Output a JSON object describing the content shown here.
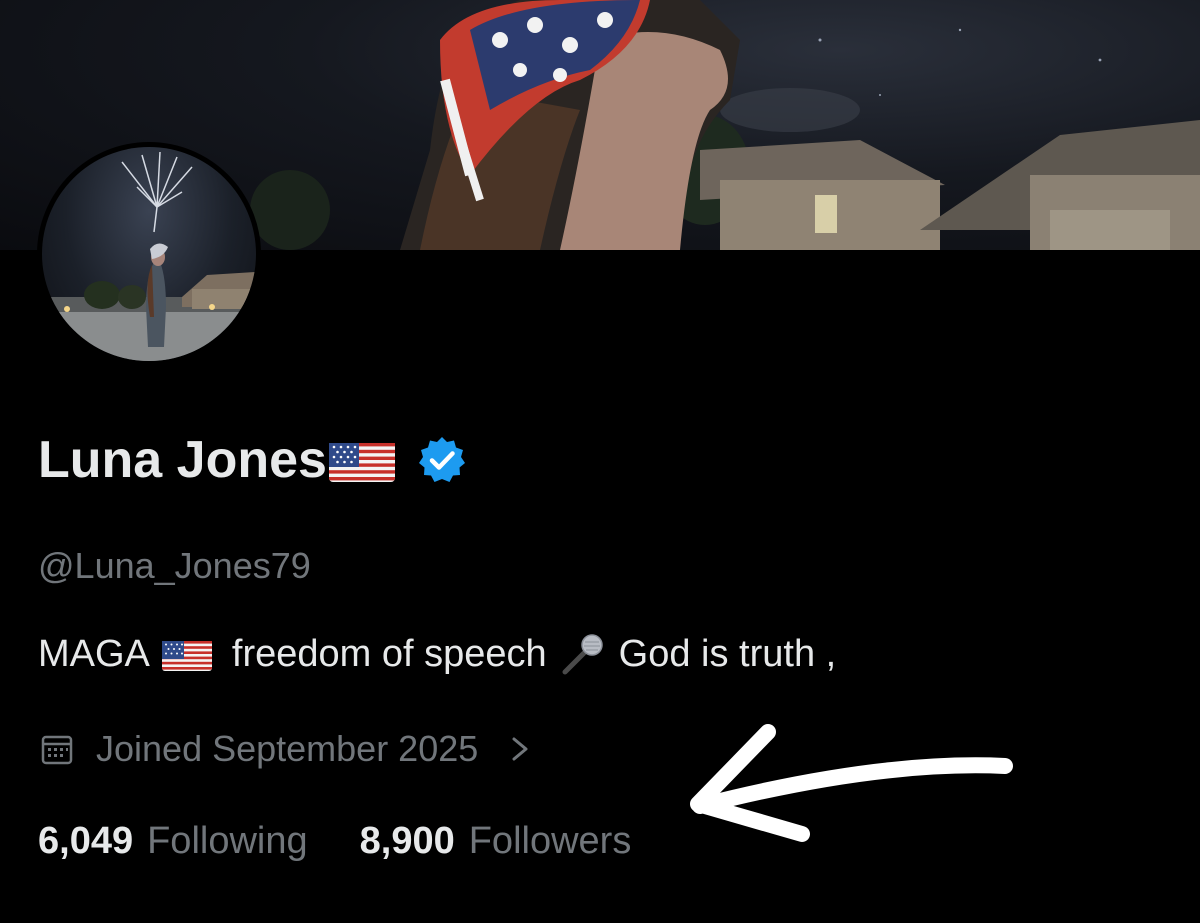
{
  "profile": {
    "display_name": "Luna Jones",
    "handle": "@Luna_Jones79",
    "bio": {
      "part1": "MAGA",
      "part2": "freedom of speech",
      "part3": "God is truth ,"
    },
    "joined": "Joined September 2025",
    "stats": {
      "following_count": "6,049",
      "following_label": "Following",
      "followers_count": "8,900",
      "followers_label": "Followers"
    }
  },
  "icons": {
    "verified": "verified-badge-icon",
    "calendar": "calendar-icon",
    "chevron": "chevron-right-icon",
    "flag": "us-flag-emoji",
    "mic": "microphone-emoji"
  },
  "colors": {
    "background": "#000000",
    "primary_text": "#e7e9ea",
    "secondary_text": "#71767b",
    "verified_blue": "#1d9bf0"
  }
}
